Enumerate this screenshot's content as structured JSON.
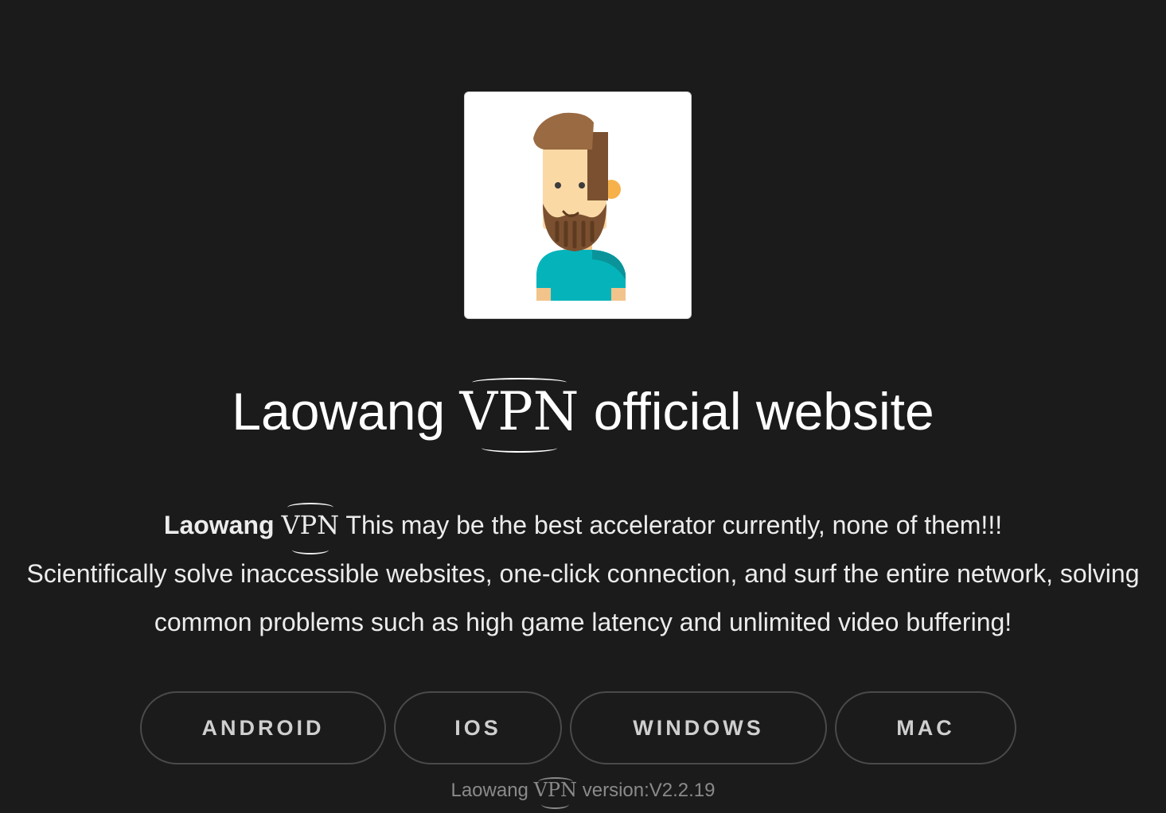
{
  "header": {
    "title_prefix": "Laowang",
    "title_mark": "VPN",
    "title_suffix": "official website"
  },
  "intro": {
    "brand": "Laowang",
    "brand_mark": "VPN",
    "line1": "This may be the best accelerator currently, none of them!!!",
    "line2": "Scientifically solve inaccessible websites, one-click connection, and surf the entire network, solving common problems such as high game latency and unlimited video buffering!"
  },
  "downloads": [
    {
      "label": "ANDROID"
    },
    {
      "label": "IOS"
    },
    {
      "label": "WINDOWS"
    },
    {
      "label": "MAC"
    }
  ],
  "footer": {
    "prefix": "Laowang",
    "mark": "VPN",
    "version_text": "version:V2.2.19"
  },
  "icons": {
    "avatar": "bearded-man-avatar-icon"
  },
  "colors": {
    "background": "#1b1b1b",
    "button_border": "#4a4a4a",
    "button_text": "#cfcfcf",
    "footer_text": "#8a8a8a"
  }
}
